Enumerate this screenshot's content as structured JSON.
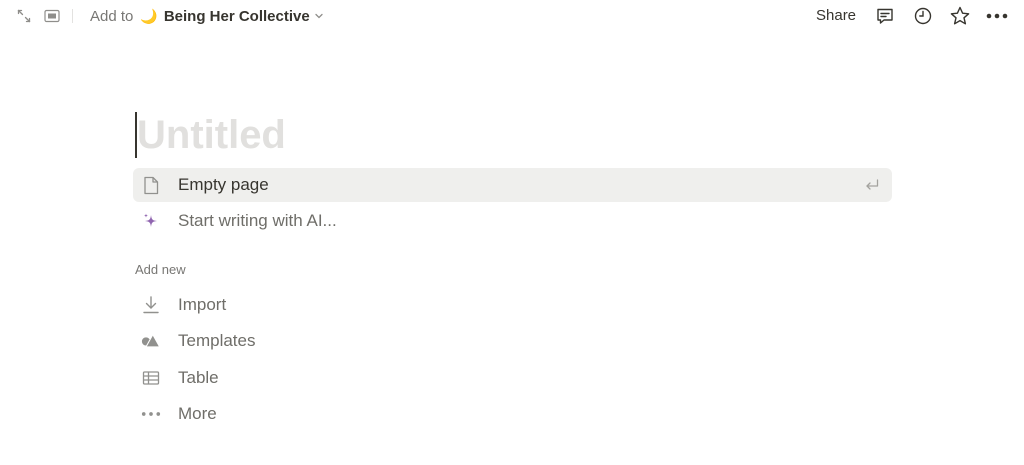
{
  "topbar": {
    "add_to_label": "Add to",
    "workspace_emoji": "🌙",
    "workspace_name": "Being Her Collective",
    "share_label": "Share"
  },
  "page": {
    "title_placeholder": "Untitled"
  },
  "suggestions": [
    {
      "label": "Empty page",
      "icon": "page-icon"
    },
    {
      "label": "Start writing with AI...",
      "icon": "ai-sparkle-icon"
    }
  ],
  "add_new": {
    "section_label": "Add new",
    "items": [
      {
        "label": "Import",
        "icon": "import-icon"
      },
      {
        "label": "Templates",
        "icon": "templates-icon"
      },
      {
        "label": "Table",
        "icon": "table-icon"
      },
      {
        "label": "More",
        "icon": "more-icon"
      }
    ]
  },
  "colors": {
    "text": "#37352f",
    "muted": "#787774",
    "placeholder": "#e1e0de",
    "hover_bg": "#efefed",
    "ai_purple": "#9065b0"
  }
}
